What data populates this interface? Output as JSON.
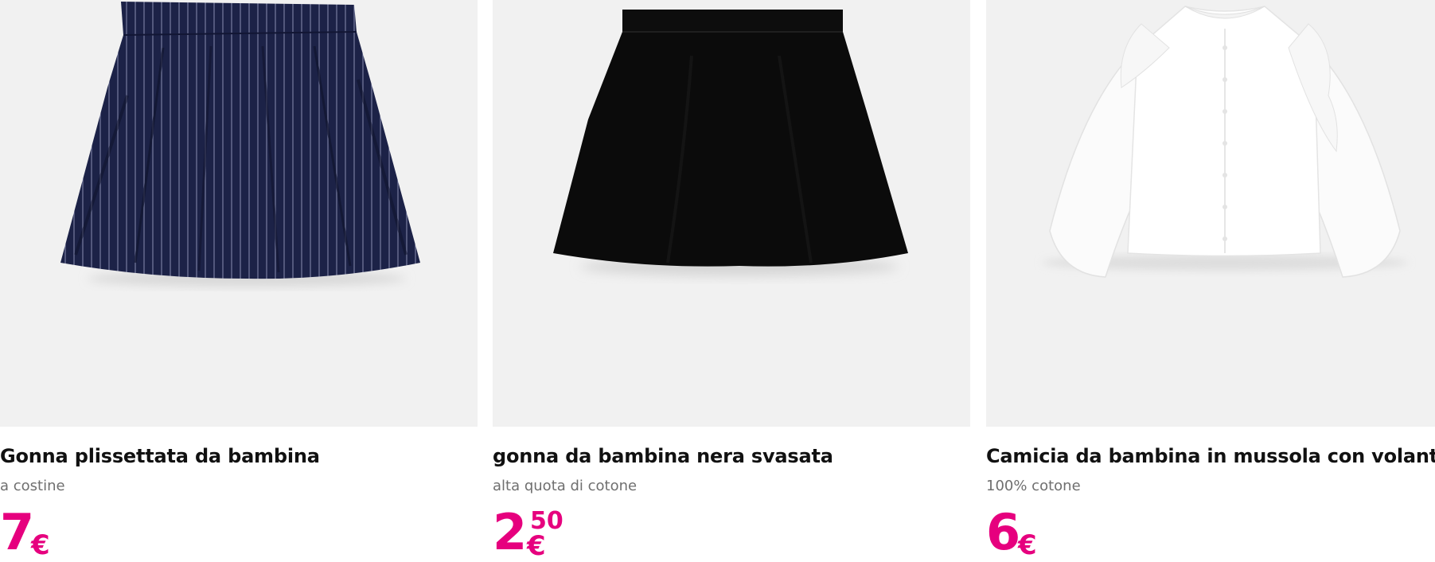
{
  "products": [
    {
      "image_alt": "Gonna plissettata blu navy gessata",
      "title": "Gonna plissettata da bambina",
      "subtitle": "a costine",
      "price_int": "7",
      "price_cents": "",
      "currency": "€"
    },
    {
      "image_alt": "Gonna nera svasata",
      "title": "gonna da bambina nera svasata",
      "subtitle": "alta quota di cotone",
      "price_int": "2",
      "price_cents": "50",
      "currency": "€"
    },
    {
      "image_alt": "Camicia bianca in mussola con volant",
      "title": "Camicia da bambina in mussola con volant in...",
      "subtitle": "100% cotone",
      "price_int": "6",
      "price_cents": "",
      "currency": "€"
    }
  ],
  "colors": {
    "price": "#e6007e",
    "image_bg": "#f1f1f1",
    "title": "#111111",
    "subtitle": "#6f6f6f"
  }
}
